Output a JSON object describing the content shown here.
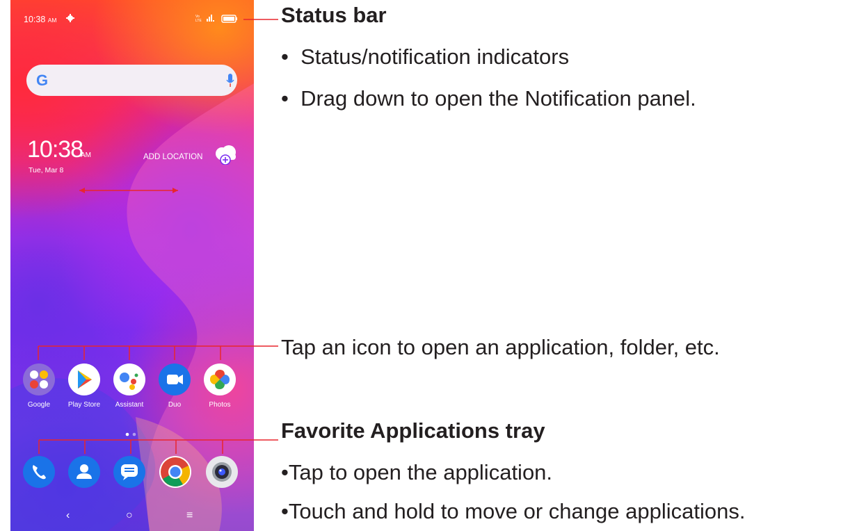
{
  "phone": {
    "status_time": "10:38",
    "status_ampm": "AM",
    "status_network": "Vo LTE",
    "clock_time": "10:38",
    "clock_ampm": "AM",
    "date": "Tue, Mar 8",
    "add_location": "ADD LOCATION",
    "search_logo": "G",
    "apps": [
      {
        "label": "Google",
        "icon": "google-folder-icon"
      },
      {
        "label": "Play Store",
        "icon": "play-store-icon"
      },
      {
        "label": "Assistant",
        "icon": "assistant-icon"
      },
      {
        "label": "Duo",
        "icon": "duo-icon"
      },
      {
        "label": "Photos",
        "icon": "photos-icon"
      }
    ],
    "dock": [
      "phone-icon",
      "contacts-icon",
      "messages-icon",
      "chrome-icon",
      "camera-icon"
    ],
    "nav": {
      "back": "‹",
      "home": "○",
      "menu": "≡"
    }
  },
  "annotations": {
    "status_bar": {
      "title": "Status bar",
      "bullets": [
        "Status/notification indicators",
        "Drag down to open the Notification panel."
      ]
    },
    "app_icons": "Tap an icon to open an application, folder, etc.",
    "tray": {
      "title": "Favorite Applications tray",
      "bullets": [
        "Tap to open the application.",
        "Touch and hold to move or change applications."
      ]
    }
  },
  "colors": {
    "callout_line": "#e8262d",
    "text": "#231f20"
  }
}
